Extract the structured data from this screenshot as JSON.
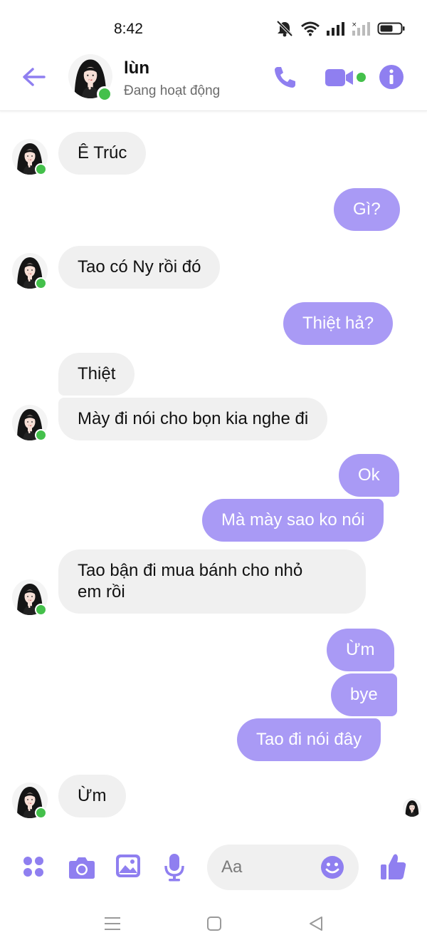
{
  "status_bar": {
    "time": "8:42"
  },
  "header": {
    "contact_name": "lùn",
    "contact_status": "Đang hoạt động"
  },
  "messages": [
    {
      "side": "in",
      "text": "Ê Trúc"
    },
    {
      "side": "out",
      "text": "Gì?"
    },
    {
      "side": "in",
      "text": "Tao có Ny rồi đó"
    },
    {
      "side": "out",
      "text": "Thiệt hả?"
    },
    {
      "side": "in",
      "text": "Thiệt"
    },
    {
      "side": "in",
      "text": "Mày đi nói cho bọn kia nghe đi"
    },
    {
      "side": "out",
      "text": "Ok"
    },
    {
      "side": "out",
      "text": "Mà mày sao ko nói"
    },
    {
      "side": "in",
      "text": "Tao bận đi mua bánh cho nhỏ\nem rồi"
    },
    {
      "side": "out",
      "text": "Ừm"
    },
    {
      "side": "out",
      "text": "bye"
    },
    {
      "side": "out",
      "text": "Tao đi nói đây"
    },
    {
      "side": "in",
      "text": "Ừm"
    }
  ],
  "composer": {
    "placeholder": "Aa"
  },
  "colors": {
    "accent": "#a99af5",
    "icon": "#8f7ff0",
    "incoming_bubble": "#f0f0f0",
    "online": "#44c04b"
  },
  "icons": {
    "header": [
      "back-arrow-icon",
      "phone-icon",
      "video-camera-icon",
      "info-icon"
    ],
    "composer": [
      "apps-grid-icon",
      "camera-icon",
      "gallery-icon",
      "microphone-icon",
      "emoji-icon",
      "thumbs-up-icon"
    ],
    "nav": [
      "menu-icon",
      "home-icon",
      "back-triangle-icon"
    ]
  }
}
